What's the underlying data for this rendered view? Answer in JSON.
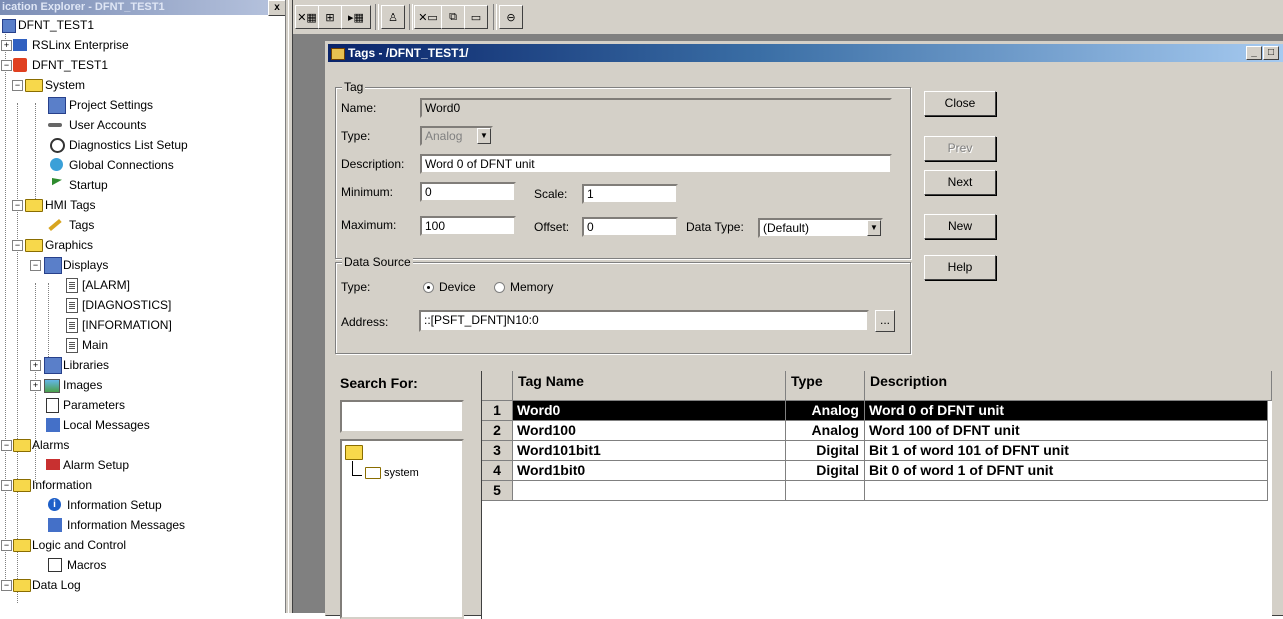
{
  "explorer": {
    "title": "ication Explorer - DFNT_TEST1",
    "close_label": "x",
    "items": [
      {
        "label": "DFNT_TEST1",
        "icon": "application-icon"
      },
      {
        "label": "RSLinx Enterprise",
        "icon": "rslinx-icon"
      },
      {
        "label": "DFNT_TEST1",
        "icon": "hmi-server-icon"
      },
      {
        "label": "System",
        "icon": "folder-icon"
      },
      {
        "label": "Project Settings",
        "icon": "settings-icon"
      },
      {
        "label": "User Accounts",
        "icon": "key-icon"
      },
      {
        "label": "Diagnostics List Setup",
        "icon": "clock-icon"
      },
      {
        "label": "Global Connections",
        "icon": "globe-icon"
      },
      {
        "label": "Startup",
        "icon": "flag-icon"
      },
      {
        "label": "HMI Tags",
        "icon": "folder-icon"
      },
      {
        "label": "Tags",
        "icon": "pencil-icon"
      },
      {
        "label": "Graphics",
        "icon": "folder-icon"
      },
      {
        "label": "Displays",
        "icon": "displays-icon"
      },
      {
        "label": "[ALARM]",
        "icon": "display-page-icon"
      },
      {
        "label": "[DIAGNOSTICS]",
        "icon": "display-page-icon"
      },
      {
        "label": "[INFORMATION]",
        "icon": "display-page-icon"
      },
      {
        "label": "Main",
        "icon": "display-page-icon"
      },
      {
        "label": "Libraries",
        "icon": "libraries-icon"
      },
      {
        "label": "Images",
        "icon": "images-icon"
      },
      {
        "label": "Parameters",
        "icon": "parameters-icon"
      },
      {
        "label": "Local Messages",
        "icon": "messages-icon"
      },
      {
        "label": "Alarms",
        "icon": "folder-icon"
      },
      {
        "label": "Alarm Setup",
        "icon": "alarm-icon"
      },
      {
        "label": "Information",
        "icon": "folder-icon"
      },
      {
        "label": "Information Setup",
        "icon": "info-icon"
      },
      {
        "label": "Information Messages",
        "icon": "messages-icon"
      },
      {
        "label": "Logic and Control",
        "icon": "folder-icon"
      },
      {
        "label": "Macros",
        "icon": "macro-icon"
      },
      {
        "label": "Data Log",
        "icon": "folder-icon"
      }
    ]
  },
  "toolbar": {
    "buttons": [
      "x-grid-icon",
      "tag-tree-icon",
      "arrow-grid-icon",
      "person-icon",
      "x-window-icon",
      "copy-window-icon",
      "window-icon",
      "database-icon"
    ]
  },
  "tagwindow": {
    "title": "Tags - /DFNT_TEST1/",
    "minimize_label": "_",
    "tag_group": "Tag",
    "name_label": "Name:",
    "name_value": "Word0",
    "type_label": "Type:",
    "type_value": "Analog",
    "description_label": "Description:",
    "description_value": "Word 0 of DFNT unit",
    "minimum_label": "Minimum:",
    "minimum_value": "0",
    "scale_label": "Scale:",
    "scale_value": "1",
    "maximum_label": "Maximum:",
    "maximum_value": "100",
    "offset_label": "Offset:",
    "offset_value": "0",
    "datatype_label": "Data Type:",
    "datatype_value": "(Default)",
    "source_group": "Data Source",
    "source_type_label": "Type:",
    "device_label": "Device",
    "memory_label": "Memory",
    "address_label": "Address:",
    "address_value": "::[PSFT_DFNT]N10:0",
    "browse_label": "...",
    "buttons": {
      "close": "Close",
      "prev": "Prev",
      "next": "Next",
      "new": "New",
      "help": "Help"
    },
    "search_label": "Search For:",
    "search_value": "",
    "folder_tree_item": "system"
  },
  "grid": {
    "headers": [
      "Tag Name",
      "Type",
      "Description"
    ],
    "rows": [
      {
        "num": "1",
        "name": "Word0",
        "type": "Analog",
        "description": "Word 0 of DFNT unit"
      },
      {
        "num": "2",
        "name": "Word100",
        "type": "Analog",
        "description": "Word 100 of DFNT unit"
      },
      {
        "num": "3",
        "name": "Word101bit1",
        "type": "Digital",
        "description": "Bit 1 of word 101 of DFNT unit"
      },
      {
        "num": "4",
        "name": "Word1bit0",
        "type": "Digital",
        "description": "Bit 0 of word 1 of DFNT unit"
      },
      {
        "num": "5",
        "name": "",
        "type": "",
        "description": ""
      }
    ]
  }
}
